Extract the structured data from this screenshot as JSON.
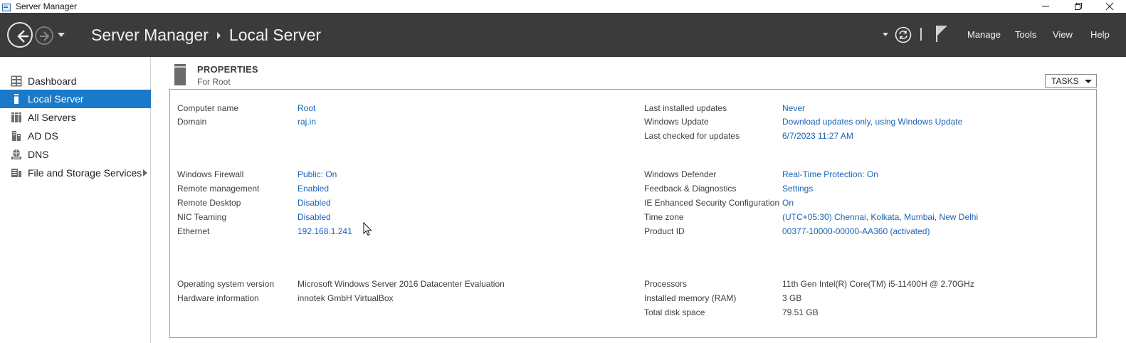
{
  "window": {
    "title": "Server Manager",
    "minimize": "—",
    "restore": "❐",
    "close": "✕"
  },
  "header": {
    "app": "Server Manager",
    "page": "Local Server",
    "menu": [
      "Manage",
      "Tools",
      "View",
      "Help"
    ]
  },
  "sidebar": {
    "items": [
      {
        "label": "Dashboard",
        "icon": "dashboard-icon"
      },
      {
        "label": "Local Server",
        "icon": "local-server-icon",
        "active": true
      },
      {
        "label": "All Servers",
        "icon": "all-servers-icon"
      },
      {
        "label": "AD DS",
        "icon": "ad-ds-icon"
      },
      {
        "label": "DNS",
        "icon": "dns-icon"
      },
      {
        "label": "File and Storage Services",
        "icon": "file-storage-icon",
        "has_submenu": true
      }
    ]
  },
  "properties": {
    "title": "PROPERTIES",
    "subtitle": "For Root",
    "tasks_label": "TASKS",
    "left": [
      {
        "label": "Computer name",
        "value": "Root",
        "link": true
      },
      {
        "label": "Domain",
        "value": "raj.in",
        "link": true
      },
      {
        "label": "Windows Firewall",
        "value": "Public: On",
        "link": true
      },
      {
        "label": "Remote management",
        "value": "Enabled",
        "link": true
      },
      {
        "label": "Remote Desktop",
        "value": "Disabled",
        "link": true
      },
      {
        "label": "NIC Teaming",
        "value": "Disabled",
        "link": true
      },
      {
        "label": "Ethernet",
        "value": "192.168.1.241",
        "link": true
      },
      {
        "label": "Operating system version",
        "value": "Microsoft Windows Server 2016 Datacenter Evaluation",
        "link": false
      },
      {
        "label": "Hardware information",
        "value": "innotek GmbH VirtualBox",
        "link": false
      }
    ],
    "right": [
      {
        "label": "Last installed updates",
        "value": "Never",
        "link": true
      },
      {
        "label": "Windows Update",
        "value": "Download updates only, using Windows Update",
        "link": true
      },
      {
        "label": "Last checked for updates",
        "value": "6/7/2023 11:27 AM",
        "link": true
      },
      {
        "label": "Windows Defender",
        "value": "Real-Time Protection: On",
        "link": true
      },
      {
        "label": "Feedback & Diagnostics",
        "value": "Settings",
        "link": true
      },
      {
        "label": "IE Enhanced Security Configuration",
        "value": "On",
        "link": true
      },
      {
        "label": "Time zone",
        "value": "(UTC+05:30) Chennai, Kolkata, Mumbai, New Delhi",
        "link": true
      },
      {
        "label": "Product ID",
        "value": "00377-10000-00000-AA360 (activated)",
        "link": true
      },
      {
        "label": "Processors",
        "value": "11th Gen Intel(R) Core(TM) i5-11400H @ 2.70GHz",
        "link": false
      },
      {
        "label": "Installed memory (RAM)",
        "value": "3 GB",
        "link": false
      },
      {
        "label": "Total disk space",
        "value": "79.51 GB",
        "link": false
      }
    ]
  },
  "colors": {
    "header_bg": "#3b3b3b",
    "active_item": "#1979ca",
    "link": "#1a63b5"
  }
}
